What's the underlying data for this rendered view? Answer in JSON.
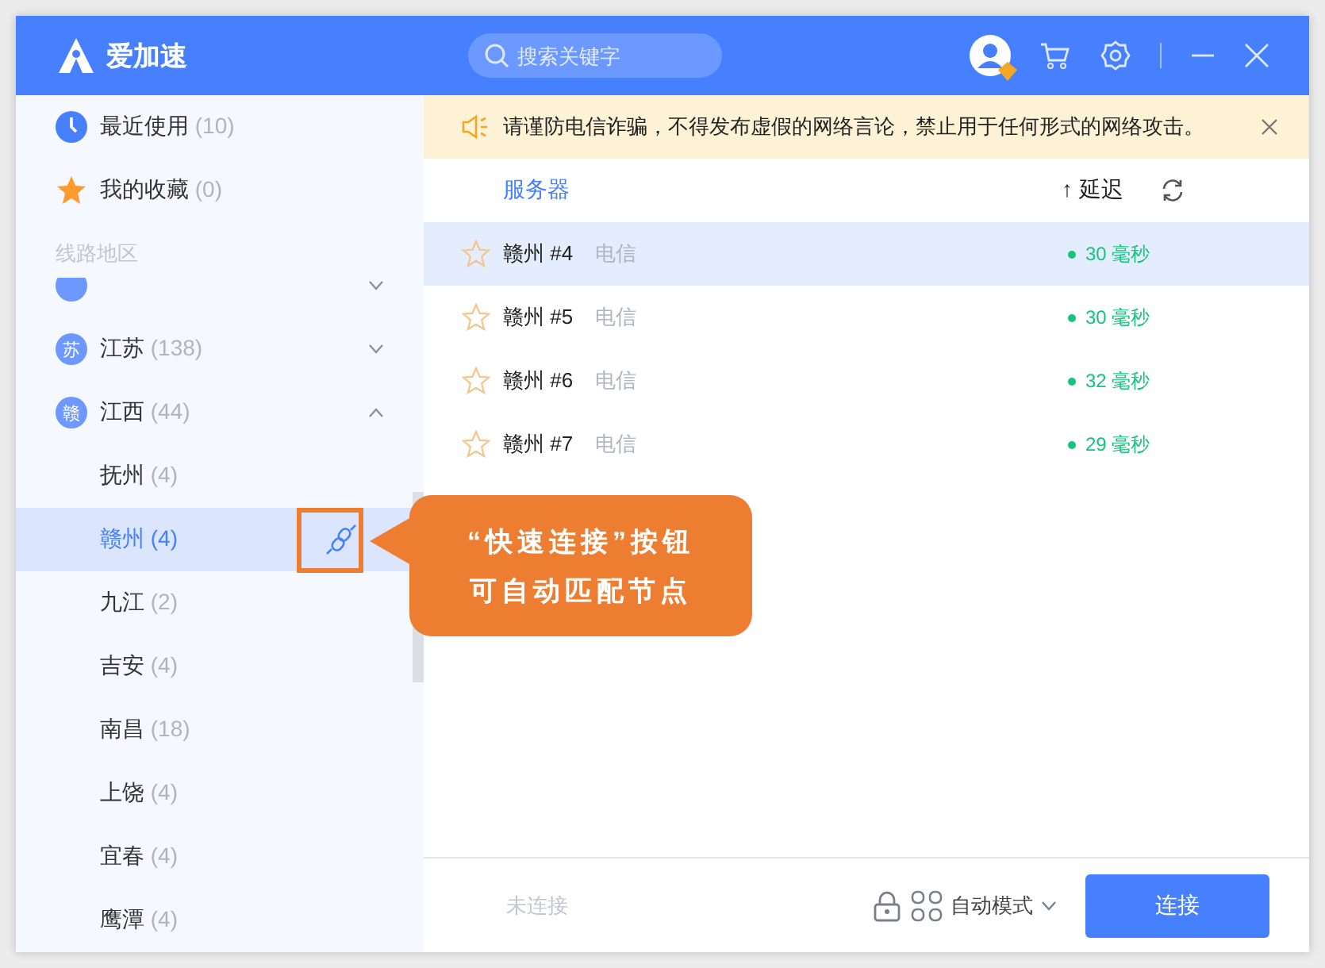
{
  "app": {
    "name": "爱加速"
  },
  "search": {
    "placeholder": "搜索关键字"
  },
  "sidebar": {
    "shortcuts": [
      {
        "kind": "recent",
        "label": "最近使用",
        "count": "(10)"
      },
      {
        "kind": "favorites",
        "label": "我的收藏",
        "count": "(0)"
      }
    ],
    "section_title": "线路地区",
    "regions": [
      {
        "expanded": false
      },
      {
        "badge": "苏",
        "label": "江苏",
        "count": "(138)",
        "expanded": false
      },
      {
        "badge": "赣",
        "label": "江西",
        "count": "(44)",
        "expanded": true,
        "children": [
          {
            "label": "抚州",
            "count": "(4)",
            "selected": false
          },
          {
            "label": "赣州",
            "count": "(4)",
            "selected": true
          },
          {
            "label": "九江",
            "count": "(2)",
            "selected": false
          },
          {
            "label": "吉安",
            "count": "(4)",
            "selected": false
          },
          {
            "label": "南昌",
            "count": "(18)",
            "selected": false
          },
          {
            "label": "上饶",
            "count": "(4)",
            "selected": false
          },
          {
            "label": "宜春",
            "count": "(4)",
            "selected": false
          },
          {
            "label": "鹰潭",
            "count": "(4)",
            "selected": false
          }
        ]
      }
    ]
  },
  "notice": {
    "text": "请谨防电信诈骗，不得发布虚假的网络言论，禁止用于任何形式的网络攻击。"
  },
  "table": {
    "server_column": "服务器",
    "sort_arrow": "↑",
    "latency_column": "延迟",
    "rows": [
      {
        "name": "赣州 #4",
        "isp": "电信",
        "latency": "30 毫秒",
        "selected": true,
        "favorite": false
      },
      {
        "name": "赣州 #5",
        "isp": "电信",
        "latency": "30 毫秒",
        "selected": false,
        "favorite": false
      },
      {
        "name": "赣州 #6",
        "isp": "电信",
        "latency": "32 毫秒",
        "selected": false,
        "favorite": false
      },
      {
        "name": "赣州 #7",
        "isp": "电信",
        "latency": "29 毫秒",
        "selected": false,
        "favorite": false
      }
    ]
  },
  "footer": {
    "status": "未连接",
    "mode": "自动模式",
    "connect_button": "连接"
  },
  "callout": {
    "lines": [
      "“快速连接”按钮",
      "可自动匹配节点"
    ]
  }
}
